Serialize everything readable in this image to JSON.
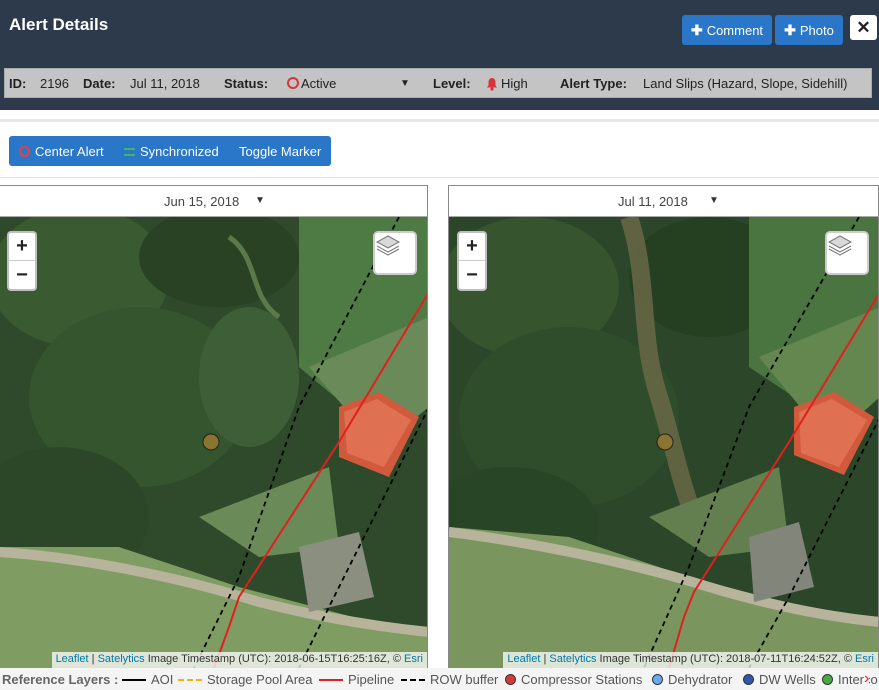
{
  "header": {
    "title": "Alert Details",
    "comment_label": "Comment",
    "photo_label": "Photo",
    "close_glyph": "✕"
  },
  "info": {
    "id_label": "ID:",
    "id_value": "2196",
    "date_label": "Date:",
    "date_value": "Jul 11, 2018",
    "status_label": "Status:",
    "status_value": "Active",
    "level_label": "Level:",
    "level_value": "High",
    "type_label": "Alert Type:",
    "type_value": "Land Slips (Hazard, Slope, Sidehill)"
  },
  "toolbar": {
    "center_label": "Center Alert",
    "sync_label": "Synchronized",
    "toggle_label": "Toggle Marker"
  },
  "maps": {
    "left": {
      "date": "Jun 15, 2018",
      "attrib_leaflet": "Leaflet",
      "attrib_sep": "|",
      "attrib_satelytics": "Satelytics",
      "attrib_text": "Image Timestamp (UTC): 2018-06-15T16:25:16Z, ©",
      "attrib_esri": "Esri"
    },
    "right": {
      "date": "Jul 11, 2018",
      "attrib_leaflet": "Leaflet",
      "attrib_sep": "|",
      "attrib_satelytics": "Satelytics",
      "attrib_text": "Image Timestamp (UTC): 2018-07-11T16:24:52Z, ©",
      "attrib_esri": "Esri"
    },
    "zoom_in": "+",
    "zoom_out": "−"
  },
  "legend": {
    "title": "Reference Layers :",
    "items": [
      "AOI",
      "Storage Pool Area",
      "Pipeline",
      "ROW buffer",
      "Compressor Stations",
      "Dehydrator",
      "DW Wells",
      "Interco"
    ]
  },
  "colors": {
    "header_bg": "#2c3a4b",
    "button_blue": "#2a77c9",
    "status_red": "#d4373a",
    "pipeline": "#e02020",
    "storage_pool": "#f0b400",
    "compressor": "#d43a3a",
    "dehydrator": "#66aaee",
    "dw_wells": "#3355aa",
    "interconnect": "#44aa44"
  }
}
